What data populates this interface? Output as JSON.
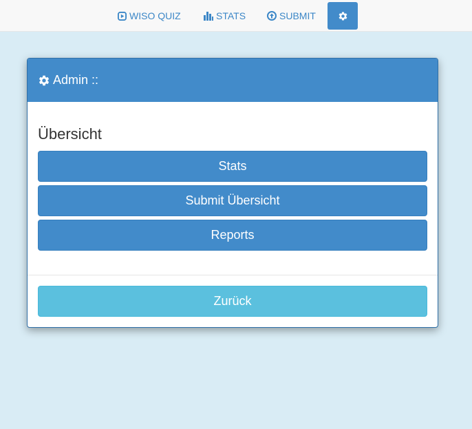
{
  "nav": {
    "quiz_label": "WISO QUIZ",
    "stats_label": "STATS",
    "submit_label": "SUBMIT",
    "quiz_icon": "play-circle-icon",
    "stats_icon": "bar-chart-icon",
    "submit_icon": "upload-circle-icon",
    "settings_icon": "gear-icon"
  },
  "card": {
    "header_title": "Admin ::",
    "header_icon": "gear-icon",
    "section_title": "Übersicht",
    "buttons": [
      {
        "label": "Stats"
      },
      {
        "label": "Submit Übersicht"
      },
      {
        "label": "Reports"
      }
    ],
    "back_label": "Zurück"
  },
  "colors": {
    "primary": "#428bca",
    "info": "#5bc0de",
    "background": "#d9ecf5",
    "nav_link": "#3c87c7"
  }
}
